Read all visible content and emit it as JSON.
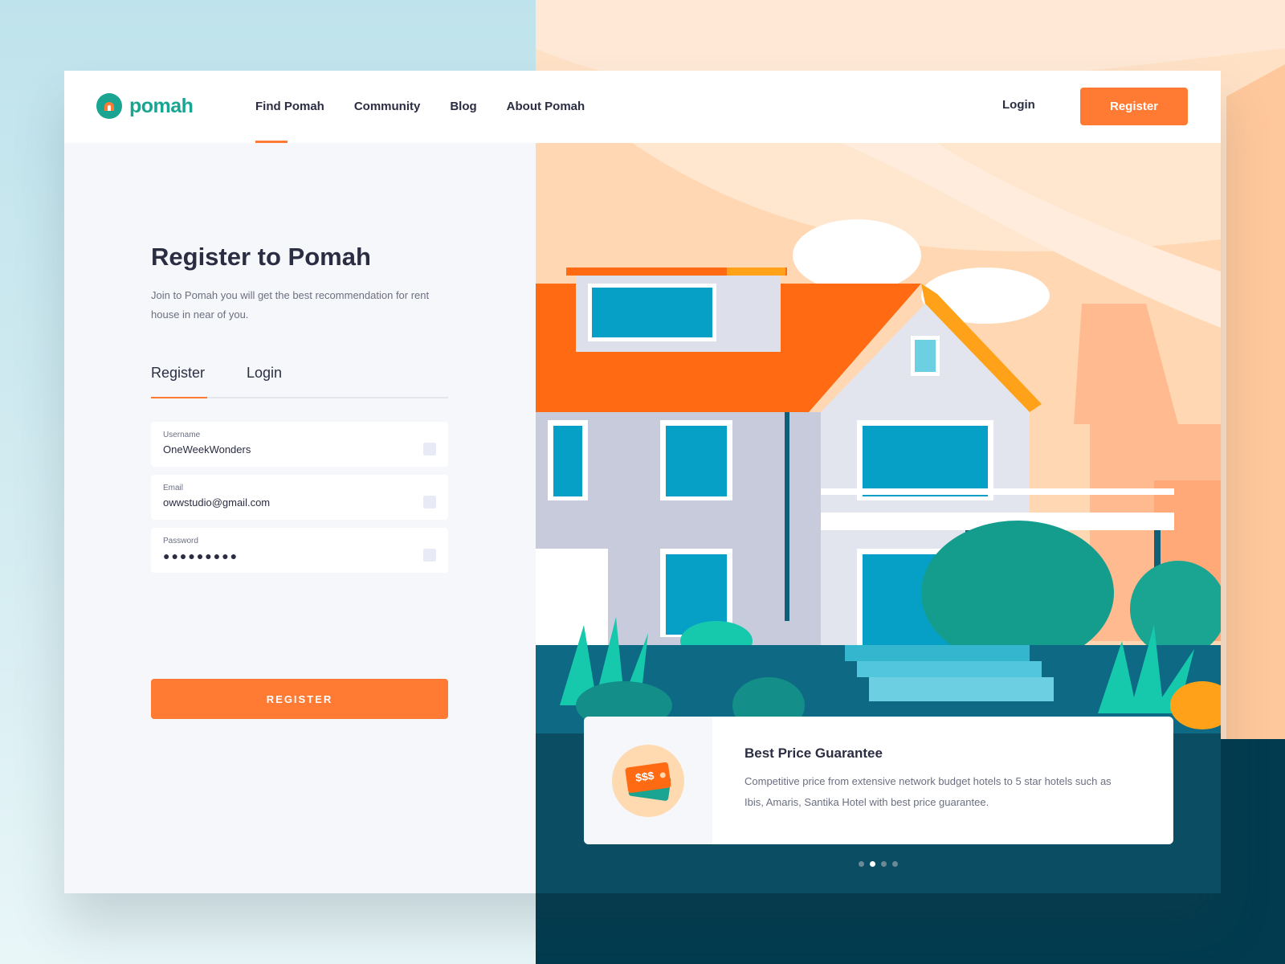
{
  "brand": {
    "name": "pomah",
    "color": "#1aa592",
    "accent": "#ff7a33"
  },
  "nav": {
    "items": [
      {
        "label": "Find Pomah",
        "active": true
      },
      {
        "label": "Community",
        "active": false
      },
      {
        "label": "Blog",
        "active": false
      },
      {
        "label": "About Pomah",
        "active": false
      }
    ],
    "login_label": "Login",
    "register_label": "Register"
  },
  "form": {
    "title": "Register to Pomah",
    "subtitle": "Join to Pomah you will get the best recommendation for rent house in near of you.",
    "tabs": [
      {
        "label": "Register",
        "active": true
      },
      {
        "label": "Login",
        "active": false
      }
    ],
    "fields": {
      "username": {
        "label": "Username",
        "value": "OneWeekWonders"
      },
      "email": {
        "label": "Email",
        "value": "owwstudio@gmail.com"
      },
      "password": {
        "label": "Password",
        "value": "●●●●●●●●●"
      }
    },
    "submit_label": "REGISTER"
  },
  "feature": {
    "icon": "price-tag-icon",
    "icon_text": "$$$",
    "title": "Best Price Guarantee",
    "description": "Competitive price from extensive network budget hotels to 5 star hotels such as Ibis, Amaris, Santika Hotel with best price guarantee."
  },
  "carousel": {
    "count": 4,
    "active_index": 1
  }
}
